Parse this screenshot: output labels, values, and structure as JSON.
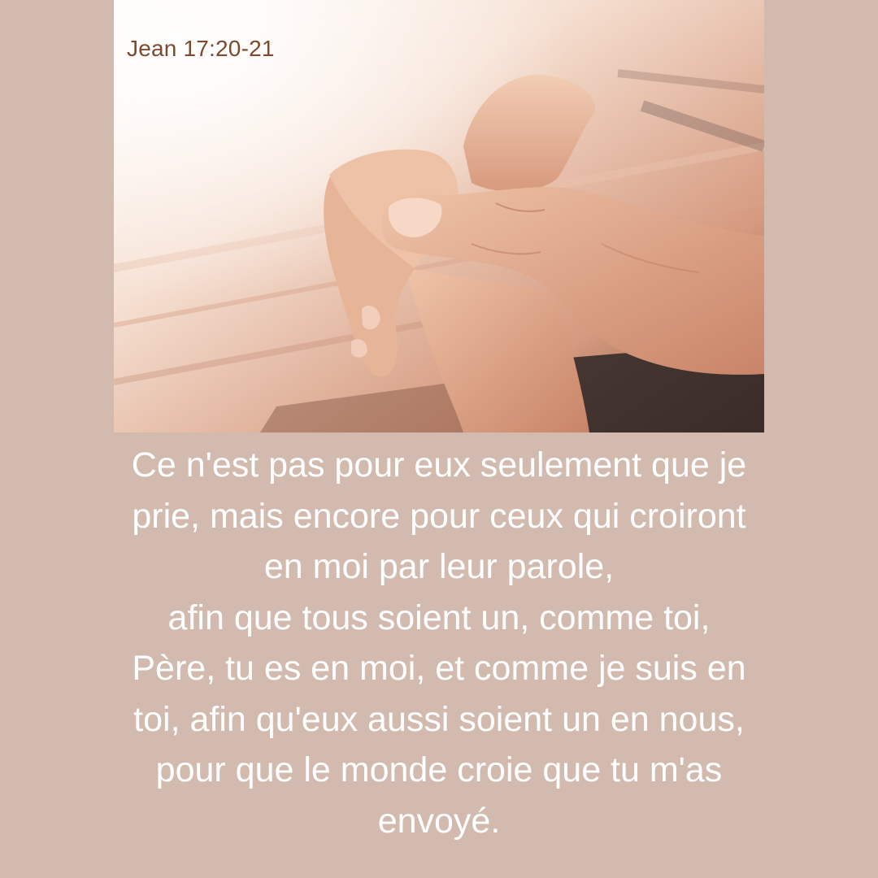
{
  "image": {
    "icon": "praying-hands-photo",
    "reference": "Jean 17:20-21"
  },
  "verse": {
    "lines": [
      "Ce n'est pas pour eux seulement que je",
      "prie, mais encore pour ceux qui croiront",
      "en moi par leur parole,",
      "afin que tous soient un, comme toi,",
      "Père, tu es en moi, et comme je suis en",
      "toi, afin qu'eux aussi soient un en nous,",
      "pour que le monde croie que tu m'as",
      "envoyé."
    ]
  },
  "colors": {
    "background": "#d2baae",
    "reference_text": "#7b4a2f",
    "verse_text": "#ffffff"
  }
}
